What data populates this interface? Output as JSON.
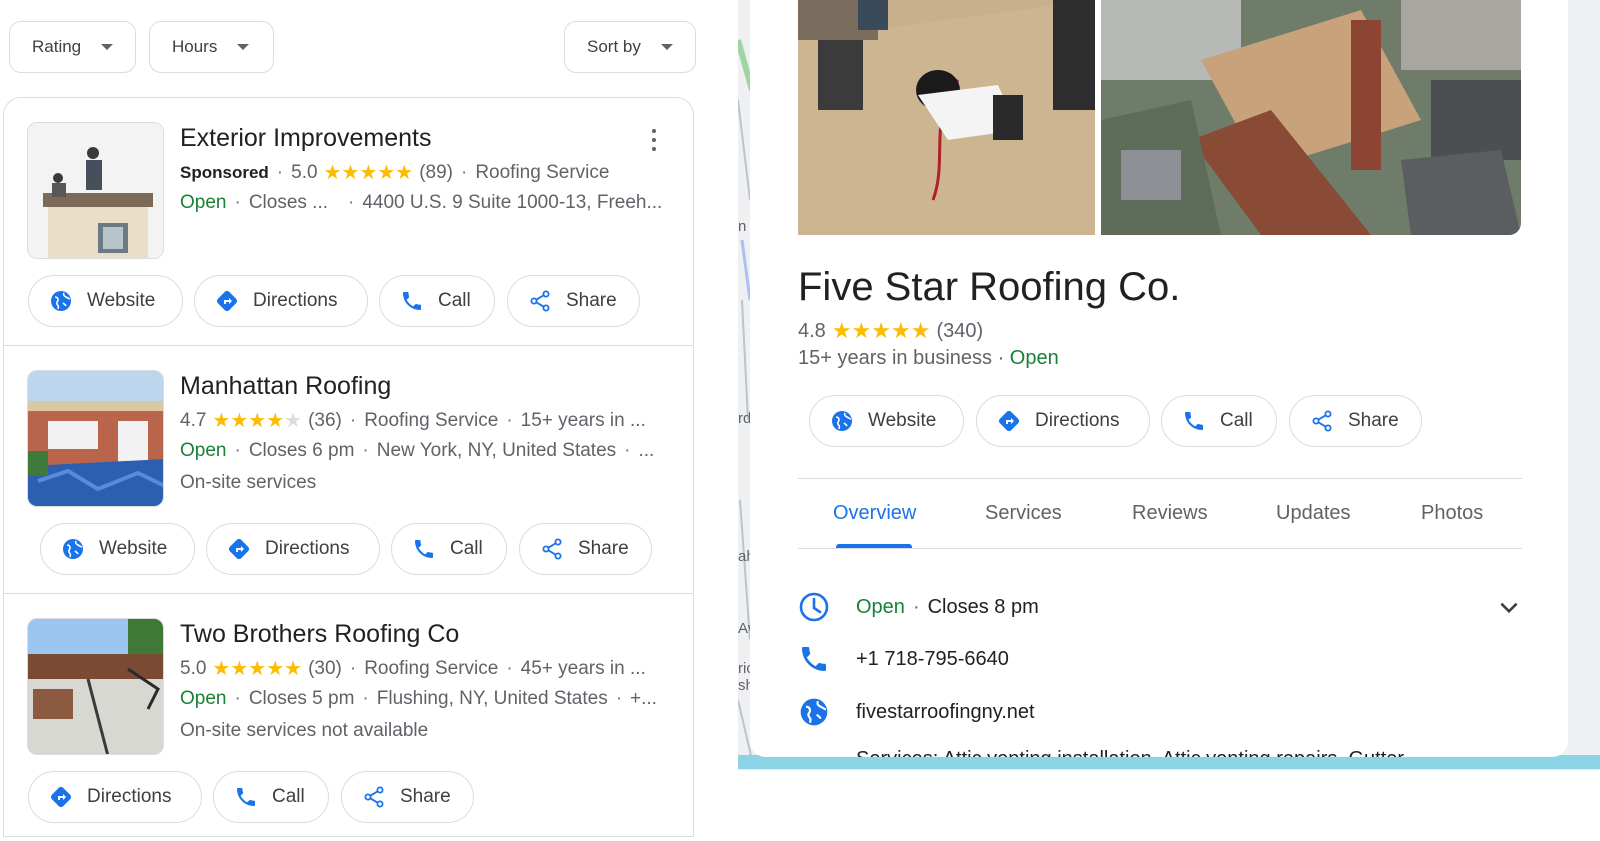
{
  "filters": {
    "rating": "Rating",
    "hours": "Hours",
    "sort": "Sort by"
  },
  "results": [
    {
      "name": "Exterior Improvements",
      "sponsored": "Sponsored",
      "rating": "5.0",
      "stars": 5,
      "reviews": "(89)",
      "category": "Roofing Service",
      "status": "Open",
      "hours": "Closes ...",
      "address": "4400 U.S. 9 Suite 1000-13, Freeh...",
      "buttons": [
        "Website",
        "Directions",
        "Call",
        "Share"
      ]
    },
    {
      "name": "Manhattan Roofing",
      "rating": "4.7",
      "stars": 4.7,
      "reviews": "(36)",
      "category": "Roofing Service",
      "extra": "15+ years in ...",
      "status": "Open",
      "hours": "Closes 6 pm",
      "address": "New York, NY, United States",
      "address_more": "...",
      "note": "On-site services",
      "buttons": [
        "Website",
        "Directions",
        "Call",
        "Share"
      ]
    },
    {
      "name": "Two Brothers Roofing Co",
      "rating": "5.0",
      "stars": 5,
      "reviews": "(30)",
      "category": "Roofing Service",
      "extra": "45+ years in ...",
      "status": "Open",
      "hours": "Closes 5 pm",
      "address": "Flushing, NY, United States",
      "address_more": "+...",
      "note": "On-site services not available",
      "buttons": [
        "Directions",
        "Call",
        "Share"
      ]
    }
  ],
  "detail": {
    "name": "Five Star Roofing Co.",
    "rating": "4.8",
    "stars": 4.8,
    "reviews": "(340)",
    "years": "15+ years in business",
    "status": "Open",
    "buttons": [
      "Website",
      "Directions",
      "Call",
      "Share"
    ],
    "tabs": [
      "Overview",
      "Services",
      "Reviews",
      "Updates",
      "Photos"
    ],
    "active_tab": "Overview",
    "hours_status": "Open",
    "hours_text": "Closes 8 pm",
    "phone": "+1 718-795-6640",
    "website": "fivestarroofingny.net",
    "services_cutoff": "Services: Attic venting installation, Attic venting repairs, Gutter"
  },
  "map_labels": [
    "n",
    "rd",
    "ah",
    "Av",
    "ric",
    "sh"
  ],
  "colors": {
    "accent": "#1a73e8",
    "open": "#188038",
    "star": "#fbbc04",
    "border": "#dadce0"
  },
  "icons": {
    "website": "globe-icon",
    "directions": "directions-icon",
    "call": "phone-icon",
    "share": "share-icon",
    "hours": "clock-icon",
    "expand": "chevron-down-icon"
  }
}
